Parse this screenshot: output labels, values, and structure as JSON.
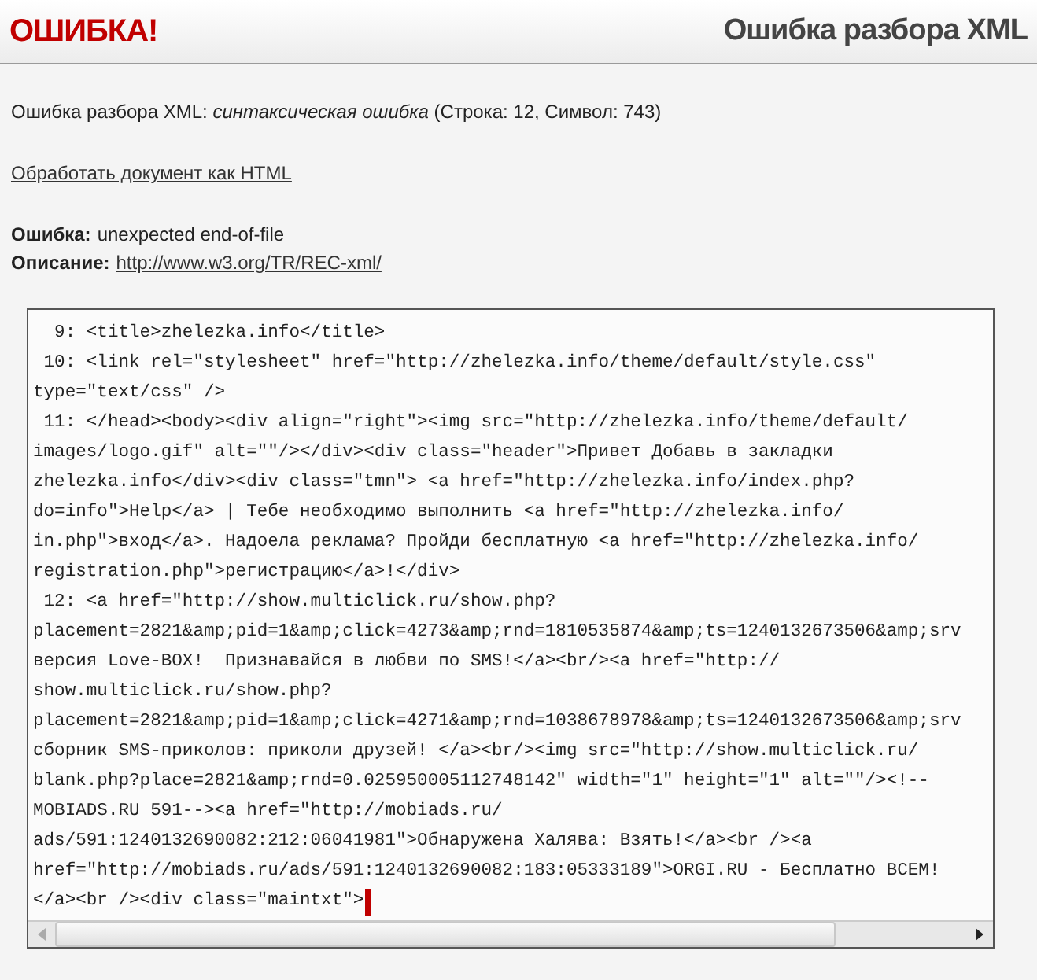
{
  "header": {
    "title": "ОШИБКА!",
    "subtitle": "Ошибка разбора XML"
  },
  "message": "Ошибка разбора XML: *синтаксическая ошибка* (Строка: 12, Символ: 743)",
  "html_link": "Обработать документ как HTML",
  "details": [
    {
      "label": "Ошибка:",
      "value": "unexpected end-of-file",
      "kind": "text"
    },
    {
      "label": "Описание:",
      "value": "http://www.w3.org/TR/REC-xml/",
      "kind": "link"
    }
  ],
  "source_lines": [
    "  9: <title>zhelezka.info</title>",
    " 10: <link rel=\"stylesheet\" href=\"http://zhelezka.info/theme/default/style.css\"",
    "type=\"text/css\" />",
    " 11: </head><body><div align=\"right\"><img src=\"http://zhelezka.info/theme/default/",
    "images/logo.gif\" alt=\"\"/></div><div class=\"header\">Привет Добавь в закладки",
    "zhelezka.info</div><div class=\"tmn\"> <a href=\"http://zhelezka.info/index.php?",
    "do=info\">Help</a> | Тебе необходимо выполнить <a href=\"http://zhelezka.info/",
    "in.php\">вход</a>. Надоела реклама? Пройди бесплатную <a href=\"http://zhelezka.info/",
    "registration.php\">регистрацию</a>!</div>",
    " 12: <a href=\"http://show.multiclick.ru/show.php?",
    "placement=2821&amp;pid=1&amp;click=4273&amp;rnd=1810535874&amp;ts=1240132673506&amp;srv",
    "версия Love-BOX!  Признавайся в любви по SMS!</a><br/><a href=\"http://",
    "show.multiclick.ru/show.php?",
    "placement=2821&amp;pid=1&amp;click=4271&amp;rnd=1038678978&amp;ts=1240132673506&amp;srv",
    "сборник SMS-приколов: приколи друзей! </a><br/><img src=\"http://show.multiclick.ru/",
    "blank.php?place=2821&amp;rnd=0.025950005112748142\" width=\"1\" height=\"1\" alt=\"\"/><!--",
    "MOBIADS.RU 591--><a href=\"http://mobiads.ru/",
    "ads/591:1240132690082:212:06041981\">Обнаружена Халява: Взять!</a><br /><a",
    "href=\"http://mobiads.ru/ads/591:1240132690082:183:05333189\">ORGI.RU - Бесплатно ВСЕМ!",
    "</a><br /><div class=\"maintxt\">"
  ]
}
